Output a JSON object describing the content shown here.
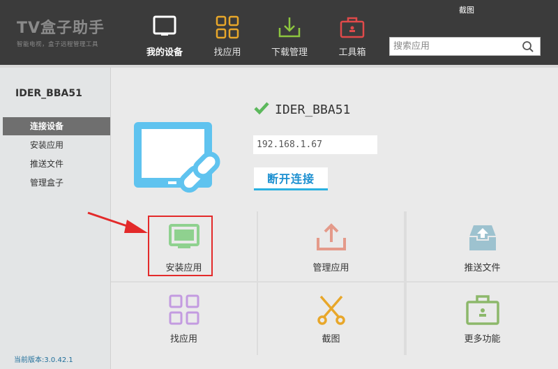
{
  "app": {
    "logo_title": "TV盒子助手",
    "logo_subtitle": "智能电视，盒子远程管理工具",
    "screenshot_link": "截图"
  },
  "nav": {
    "my_devices": "我的设备",
    "find_apps": "找应用",
    "downloads": "下载管理",
    "toolbox": "工具箱"
  },
  "search": {
    "placeholder": "搜索应用"
  },
  "sidebar": {
    "device_name": "IDER_BBA51",
    "items": [
      {
        "label": "连接设备"
      },
      {
        "label": "安装应用"
      },
      {
        "label": "推送文件"
      },
      {
        "label": "管理盒子"
      }
    ],
    "version": "当前版本:3.0.42.1"
  },
  "device": {
    "name": "IDER_BBA51",
    "ip": "192.168.1.67",
    "disconnect_label": "断开连接"
  },
  "tiles": [
    {
      "label": "安装应用",
      "icon": "tv-icon"
    },
    {
      "label": "管理应用",
      "icon": "upload-icon"
    },
    {
      "label": "推送文件",
      "icon": "inbox-upload-icon"
    },
    {
      "label": "找应用",
      "icon": "grid-icon"
    },
    {
      "label": "截图",
      "icon": "scissors-icon"
    },
    {
      "label": "更多功能",
      "icon": "toolbox-icon"
    }
  ],
  "colors": {
    "accent_blue": "#29b0e0",
    "check_green": "#5cb85c",
    "highlight_red": "#e32a2a"
  }
}
